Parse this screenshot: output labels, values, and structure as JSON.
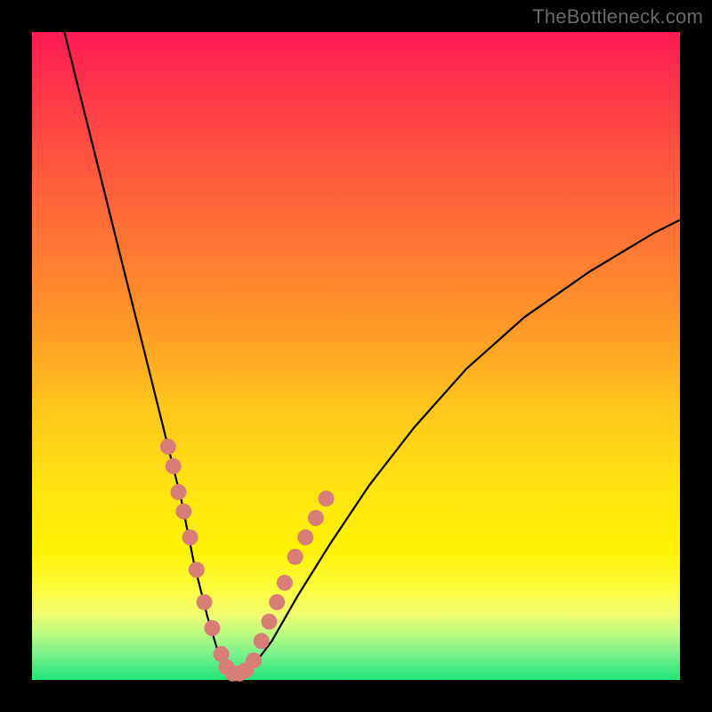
{
  "watermark": "TheBottleneck.com",
  "chart_data": {
    "type": "line",
    "title": "",
    "xlabel": "",
    "ylabel": "",
    "xlim": [
      0,
      100
    ],
    "ylim": [
      0,
      100
    ],
    "grid": false,
    "series": [
      {
        "name": "bottleneck-curve",
        "x": [
          5,
          8,
          11,
          14,
          17,
          20,
          23,
          25,
          27,
          28.5,
          30,
          32,
          34,
          37,
          41,
          46,
          52,
          59,
          67,
          76,
          86,
          96,
          100
        ],
        "y": [
          100,
          88,
          76,
          64,
          52,
          40,
          28,
          18,
          10,
          5,
          2,
          1,
          2,
          6,
          13,
          21,
          30,
          39,
          48,
          56,
          63,
          69,
          71
        ]
      }
    ],
    "dots": {
      "name": "highlight-points",
      "color": "#d87e77",
      "left_branch": [
        {
          "x": 21.0,
          "y": 36
        },
        {
          "x": 21.8,
          "y": 33
        },
        {
          "x": 22.6,
          "y": 29
        },
        {
          "x": 23.4,
          "y": 26
        },
        {
          "x": 24.4,
          "y": 22
        },
        {
          "x": 25.4,
          "y": 17
        },
        {
          "x": 26.6,
          "y": 12
        },
        {
          "x": 27.8,
          "y": 8
        }
      ],
      "trough": [
        {
          "x": 29.2,
          "y": 4
        },
        {
          "x": 30.0,
          "y": 2
        },
        {
          "x": 31.0,
          "y": 1
        },
        {
          "x": 32.0,
          "y": 1
        },
        {
          "x": 33.0,
          "y": 1.5
        },
        {
          "x": 34.2,
          "y": 3
        }
      ],
      "right_branch": [
        {
          "x": 35.4,
          "y": 6
        },
        {
          "x": 36.6,
          "y": 9
        },
        {
          "x": 37.8,
          "y": 12
        },
        {
          "x": 39.0,
          "y": 15
        },
        {
          "x": 40.6,
          "y": 19
        },
        {
          "x": 42.2,
          "y": 22
        },
        {
          "x": 43.8,
          "y": 25
        },
        {
          "x": 45.4,
          "y": 28
        }
      ]
    },
    "gradient_stops": [
      {
        "pos": 0,
        "color": "#ff1a53"
      },
      {
        "pos": 50,
        "color": "#ffaa20"
      },
      {
        "pos": 80,
        "color": "#fff206"
      },
      {
        "pos": 100,
        "color": "#20e67a"
      }
    ]
  }
}
